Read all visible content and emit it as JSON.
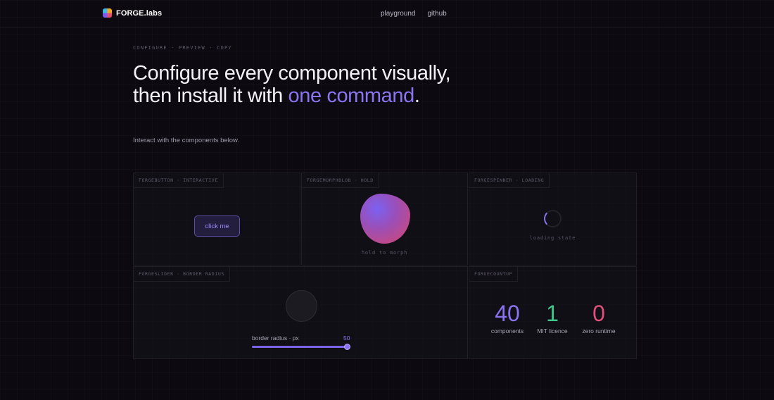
{
  "header": {
    "brand": "FORGE.labs",
    "nav": [
      "playground",
      "github"
    ]
  },
  "hero": {
    "eyebrow": "CONFIGURE · PREVIEW · COPY",
    "headline_line1": "Configure every component visually,",
    "headline_line2_start": "then install it with ",
    "headline_accent": "one command",
    "headline_end": ".",
    "subline": "Interact with the components below."
  },
  "panels": {
    "button": {
      "tag": "FORGEBUTTON · INTERACTIVE",
      "label": "click me"
    },
    "morph": {
      "tag": "FORGEMORPHBLOB · HOLD",
      "caption": "hold to morph"
    },
    "spinner": {
      "tag": "FORGESPINNER · LOADING",
      "caption": "loading state"
    },
    "slider": {
      "tag": "FORGESLIDER · BORDER RADIUS",
      "label": "border radius · px",
      "value": "50",
      "fraction": 1.0
    },
    "countup": {
      "tag": "FORGECOUNTUP",
      "stats": [
        {
          "value": "40",
          "label": "components",
          "color": "#8c74f0"
        },
        {
          "value": "1",
          "label": "MIT licence",
          "color": "#3ec98a"
        },
        {
          "value": "0",
          "label": "zero runtime",
          "color": "#e0507a"
        }
      ]
    }
  },
  "colors": {
    "accent": "#8c74f0",
    "background": "#0c0a10"
  }
}
